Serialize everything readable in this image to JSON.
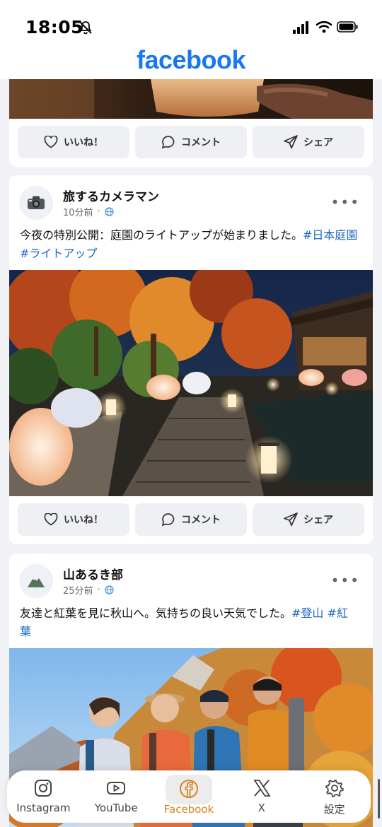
{
  "status_bar": {
    "time": "18:05"
  },
  "app": {
    "logo": "facebook",
    "brand_color": "#1877f2",
    "accent_active": "#d9831c"
  },
  "actions": {
    "like": "いいね！",
    "comment": "コメント",
    "share": "シェア"
  },
  "posts": [
    {
      "author": "旅するカメラマン",
      "time": "10分前",
      "avatar_icon": "camera-icon",
      "text": "今夜の特別公開：庭園のライトアップが始まりました。",
      "hashtags": [
        "#日本庭園",
        "#ライトアップ"
      ],
      "image": "illuminated-japanese-garden-night"
    },
    {
      "author": "山あるき部",
      "time": "25分前",
      "avatar_icon": "mountain-icon",
      "text": "友達と紅葉を見に秋山へ。気持ちの良い天気でした。",
      "hashtags": [
        "#登山",
        "#紅葉"
      ],
      "image": "hikers-autumn-mountain"
    }
  ],
  "nav": {
    "items": [
      {
        "label": "Instagram",
        "icon": "instagram-icon"
      },
      {
        "label": "YouTube",
        "icon": "youtube-icon"
      },
      {
        "label": "Facebook",
        "icon": "facebook-icon",
        "active": true
      },
      {
        "label": "X",
        "icon": "x-icon"
      },
      {
        "label": "設定",
        "icon": "gear-icon"
      }
    ]
  }
}
